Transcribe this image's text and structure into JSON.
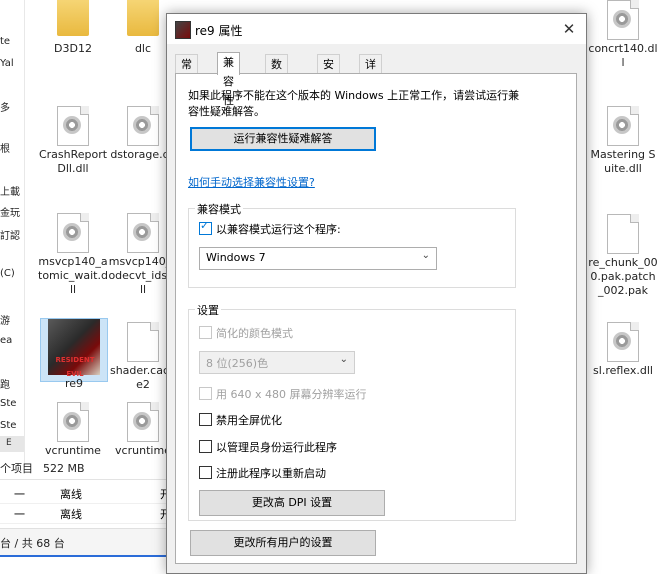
{
  "explorer": {
    "left_fragments": [
      "te",
      "Yal",
      "多",
      "根",
      "上載",
      "金玩",
      "訂認",
      "(C)",
      "游",
      "ea",
      "跑",
      "Ste",
      "Ste"
    ],
    "scroll_arrow": "E",
    "status": {
      "count": "个项目",
      "size": "522 MB"
    },
    "rows": [
      {
        "c1": "一",
        "c2": "离线",
        "c3": "开"
      },
      {
        "c1": "一",
        "c2": "离线",
        "c3": "开"
      }
    ],
    "bottom_text": "台 / 共 68 台",
    "files": [
      {
        "name": "D3D12",
        "type": "folder"
      },
      {
        "name": "dlc",
        "type": "folder"
      },
      {
        "name": "CrashReportDll.dll",
        "type": "dll"
      },
      {
        "name": "dstorage.dll",
        "type": "dll"
      },
      {
        "name": "msvcp140_atomic_wait.dll",
        "type": "dll"
      },
      {
        "name": "msvcp140_codecvt_ids.dll",
        "type": "dll"
      },
      {
        "name": "re9",
        "type": "exe"
      },
      {
        "name": "shader.cache2",
        "type": "doc"
      },
      {
        "name": "vcruntime",
        "type": "dll"
      },
      {
        "name": "vcruntime",
        "type": "dll"
      },
      {
        "name": "concrt140.dll",
        "type": "dll"
      },
      {
        "name": "Mastering Suite.dll",
        "type": "dll"
      },
      {
        "name": "re_chunk_000.pak.patch_002.pak",
        "type": "doc"
      },
      {
        "name": "sl.reflex.dll",
        "type": "dll"
      }
    ],
    "exe_logo_text": "RESIDENT EVIL"
  },
  "dialog": {
    "title": "re9 属性",
    "close_glyph": "✕",
    "tabs": [
      "常规",
      "兼容性",
      "数字签名",
      "安全",
      "详细信息"
    ],
    "active_tab": "兼容性",
    "intro_text": "如果此程序不能在这个版本的 Windows 上正常工作，请尝试运行兼容性疑难解答。",
    "troubleshoot_button": "运行兼容性疑难解答",
    "manual_link": "如何手动选择兼容性设置?",
    "compat_group": {
      "title": "兼容模式",
      "checkbox_label": "以兼容模式运行这个程序:",
      "checked": true,
      "os_value": "Windows 7"
    },
    "settings_group": {
      "title": "设置",
      "reduced_color_label": "简化的颜色模式",
      "color_value": "8 位(256)色",
      "res_640_label": "用 640 x 480 屏幕分辨率运行",
      "fullscreen_opt_label": "禁用全屏优化",
      "run_as_admin_label": "以管理员身份运行此程序",
      "register_restart_label": "注册此程序以重新启动",
      "dpi_button": "更改高 DPI 设置"
    },
    "all_users_button": "更改所有用户的设置"
  }
}
